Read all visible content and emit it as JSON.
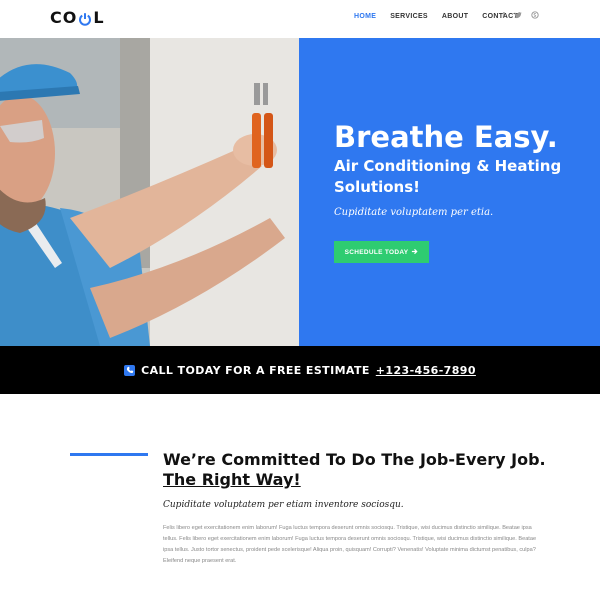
{
  "header": {
    "logo_text_left": "CO",
    "logo_text_right": "L",
    "nav": [
      {
        "label": "HOME",
        "active": true
      },
      {
        "label": "SERVICES",
        "active": false
      },
      {
        "label": "ABOUT",
        "active": false
      },
      {
        "label": "CONTACT",
        "active": false
      }
    ],
    "social_icons": [
      "facebook-icon",
      "twitter-icon",
      "skype-icon"
    ]
  },
  "hero": {
    "title": "Breathe Easy.",
    "subtitle": "Air Conditioning & Heating Solutions!",
    "tagline": "Cupiditate voluptatem per etia.",
    "button_label": "SCHEDULE TODAY",
    "panel_color": "#2f78f0",
    "button_color": "#2ecc71"
  },
  "callbar": {
    "text": "CALL TODAY FOR A FREE ESTIMATE",
    "phone": "+123-456-7890"
  },
  "commitment": {
    "title_line1": "We’re Committed To Do The Job-Every Job.",
    "title_line2": "The Right Way!",
    "tagline": "Cupiditate voluptatem per etiam inventore sociosqu.",
    "body": "Felis libero eget exercitationem enim laborum! Fuga luctus tempora deserunt omnis sociosqu. Tristique, wisi ducimus distinctio similique. Beatae ipsa tellus. Felis libero eget exercitationem enim laborum! Fuga luctus tempora deserunt omnis sociosqu. Tristique, wisi ducimus distinctio similique. Beatae ipsa tellus. Justo tortor senectus, proident pede scelerisque! Aliqua proin, quisquam! Corrupti? Venenatis! Voluptate minima dictumst penatibus, culpa? Eleifend neque praesent erat."
  },
  "colors": {
    "accent": "#2f78f0",
    "cta_green": "#2ecc71",
    "callbar_bg": "#000000"
  }
}
